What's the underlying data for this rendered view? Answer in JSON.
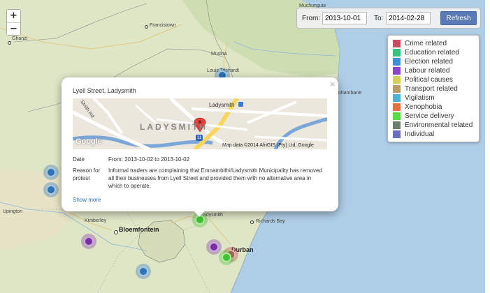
{
  "zoom": {
    "in_label": "+",
    "out_label": "−"
  },
  "places": {
    "muchungute": "Muchungute",
    "ghanzi": "Ghanzi",
    "francistown": "Francistown",
    "musina": "Musina",
    "louis_trichardt": "Louis Trichardt",
    "inhambane": "nhambane",
    "upington": "Upington",
    "kimberley": "Kimberley",
    "bloemfontein": "Bloemfontein",
    "ladysmith": "Ladysmith",
    "richards_bay": "Richards Bay",
    "durban": "Durban"
  },
  "daterange": {
    "from_label": "From:",
    "from_value": "2013-10-01",
    "to_label": "To:",
    "to_value": "2014-02-28",
    "refresh_label": "Refresh"
  },
  "legend": [
    {
      "label": "Crime related",
      "color": "#cc4d5f"
    },
    {
      "label": "Education related",
      "color": "#33c47d"
    },
    {
      "label": "Election related",
      "color": "#3f8fd9"
    },
    {
      "label": "Labour related",
      "color": "#8e44c8"
    },
    {
      "label": "Political causes",
      "color": "#d6d05a"
    },
    {
      "label": "Transport related",
      "color": "#b99b63"
    },
    {
      "label": "Vigilatism",
      "color": "#4ab3d6"
    },
    {
      "label": "Xenophobia",
      "color": "#e5703d"
    },
    {
      "label": "Service delivery",
      "color": "#55e040"
    },
    {
      "label": "Environmental related",
      "color": "#6b7f6b"
    },
    {
      "label": "Individual",
      "color": "#6a6fc4"
    }
  ],
  "markers": [
    {
      "category": "Election related",
      "color": "#2c73b8"
    },
    {
      "category": "Election related",
      "color": "#2c73b8"
    },
    {
      "category": "Election related",
      "color": "#2c73b8"
    },
    {
      "category": "Labour related",
      "color": "#7a2ea5"
    },
    {
      "category": "Election related",
      "color": "#2c73b8"
    },
    {
      "category": "Service delivery",
      "color": "#3fc42e"
    },
    {
      "category": "Labour related",
      "color": "#7a2ea5"
    },
    {
      "category": "Crime related",
      "color": "#c03b4f"
    },
    {
      "category": "Service delivery",
      "color": "#3fc42e"
    }
  ],
  "popup": {
    "close_icon": "×",
    "title": "Lyell Street, Ladysmith",
    "map_thumb": {
      "town_label": "LADYSMITH",
      "place_label": "Ladysmith",
      "road_label": "Smith Rd",
      "attribution": "Map data ©2014 AfriGIS (Pty) Ltd, Google",
      "google_logo": "Google",
      "route_badge": "11"
    },
    "date_label": "Date",
    "date_value": "From: 2013-10-02 to 2013-10-02",
    "reason_label": "Reason for protest",
    "reason_value": "Informal traders are complaining that Emnambithi/Ladysmith Municipality has removed all their businesses from Lyell Street and provided them with no alternative area in which to operate.",
    "more_link": "Show more"
  }
}
